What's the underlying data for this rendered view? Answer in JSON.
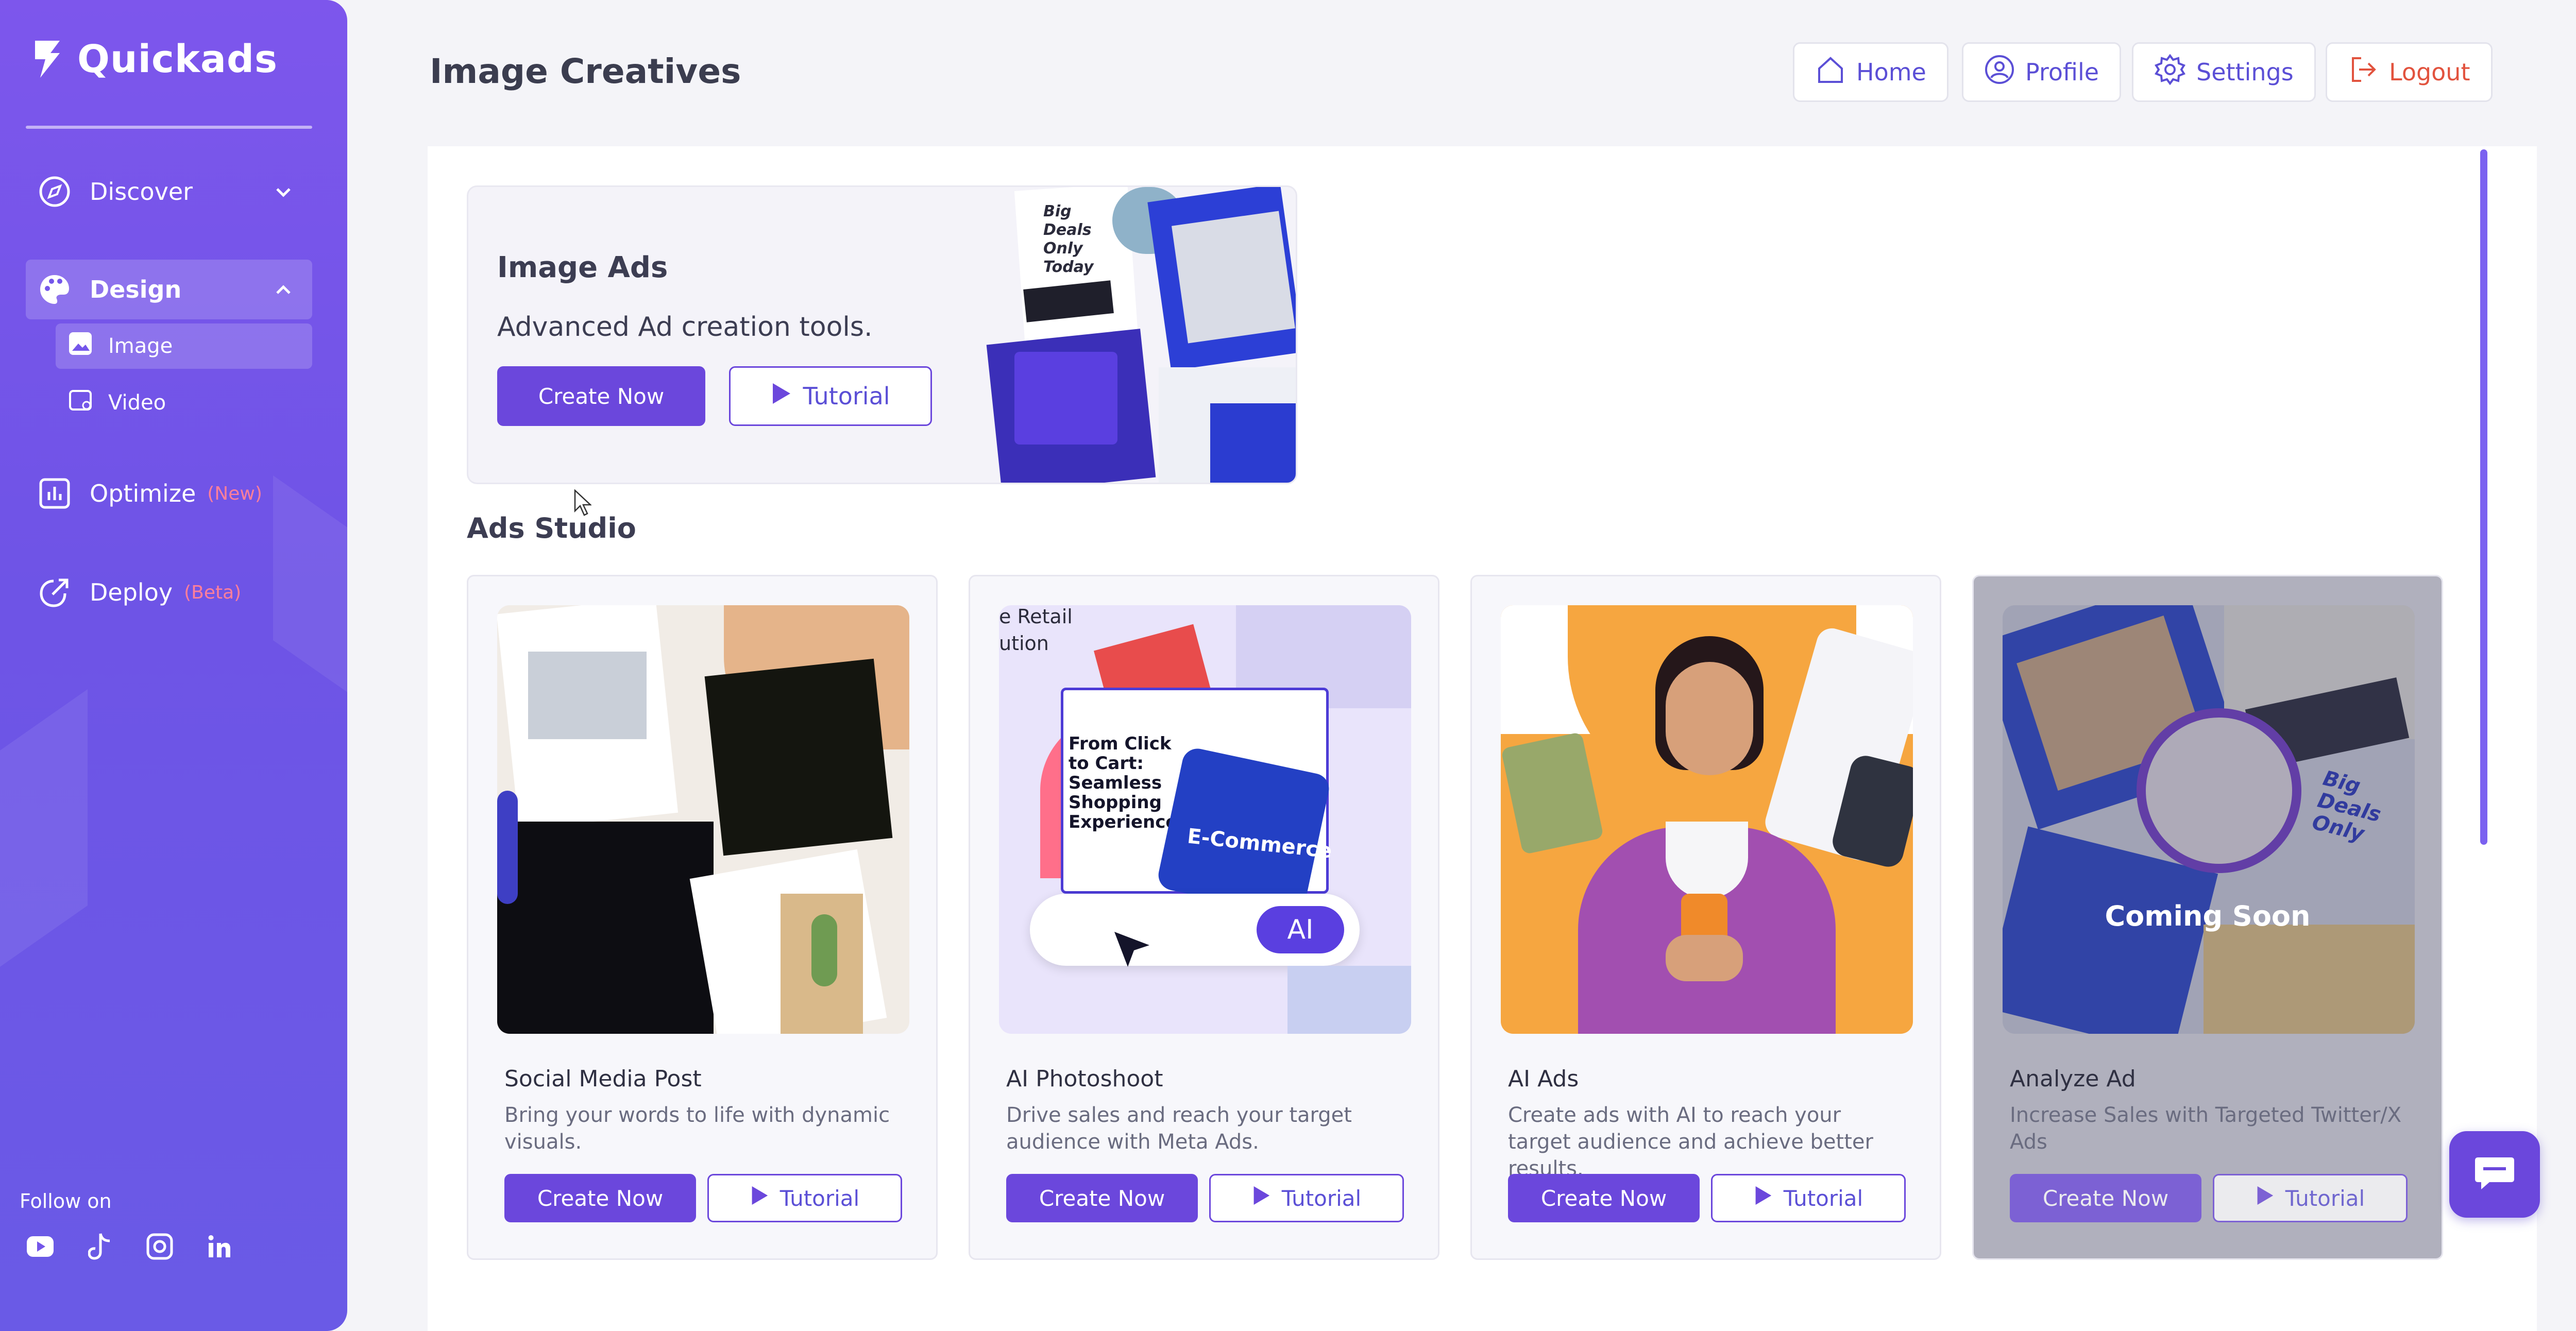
{
  "app": {
    "name": "Quickads"
  },
  "colors": {
    "accent": "#6b47dc",
    "sidebar": "#7456ea",
    "danger": "#e2533e",
    "new_tag": "#ff7f9a"
  },
  "sidebar": {
    "items": [
      {
        "label": "Discover",
        "icon": "compass-icon"
      },
      {
        "label": "Design",
        "icon": "palette-icon",
        "children": [
          {
            "label": "Image",
            "icon": "image-icon"
          },
          {
            "label": "Video",
            "icon": "video-icon"
          }
        ]
      },
      {
        "label": "Optimize",
        "tag": "(New)",
        "icon": "bar-chart-icon"
      },
      {
        "label": "Deploy",
        "tag": "(Beta)",
        "icon": "share-icon"
      }
    ],
    "follow_label": "Follow on",
    "socials": [
      "youtube-icon",
      "tiktok-icon",
      "instagram-icon",
      "linkedin-icon"
    ]
  },
  "header": {
    "title": "Image Creatives",
    "buttons": {
      "home": "Home",
      "profile": "Profile",
      "settings": "Settings",
      "logout": "Logout"
    }
  },
  "image_ads": {
    "title": "Image Ads",
    "description": "Advanced Ad creation tools.",
    "create": "Create Now",
    "tutorial": "Tutorial",
    "collage_text": {
      "big_deals": "Big Deals Only Today"
    }
  },
  "ads_studio": {
    "title": "Ads Studio",
    "cards": [
      {
        "name": "Social Media Post",
        "description": "Bring your words to life with dynamic visuals.",
        "create": "Create Now",
        "tutorial": "Tutorial"
      },
      {
        "name": "AI Photoshoot",
        "description": "Drive sales and reach your target audience with Meta Ads.",
        "create": "Create Now",
        "tutorial": "Tutorial",
        "thumb_text": {
          "retail": "e Retail",
          "ution": "ution",
          "headline": "From Click to Cart: Seamless Shopping Experiences",
          "badge": "E-Commerce",
          "ai": "AI"
        }
      },
      {
        "name": "AI Ads",
        "description": "Create ads with AI to reach your target audience and achieve better results.",
        "create": "Create Now",
        "tutorial": "Tutorial"
      },
      {
        "name": "Analyze Ad",
        "description": "Increase Sales with Targeted Twitter/X Ads",
        "create": "Create Now",
        "tutorial": "Tutorial",
        "overlay": "Coming Soon",
        "thumb_text": {
          "big": "Big Deals Only"
        }
      }
    ]
  }
}
